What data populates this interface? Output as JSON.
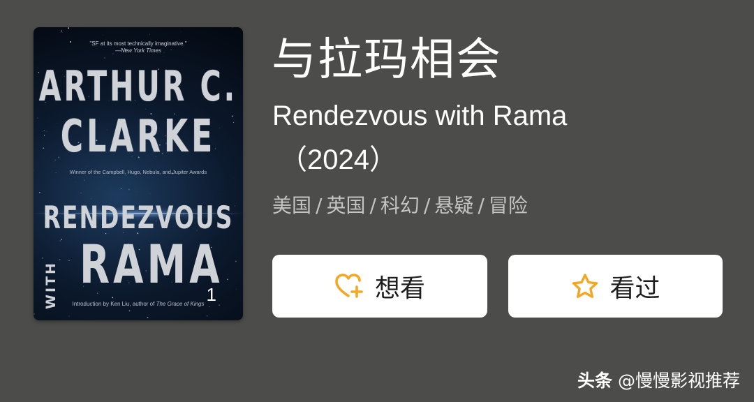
{
  "cover": {
    "quote": "\"SF at its most technically imaginative.\"",
    "quote_source": "—New York Times",
    "author_line1": "ARTHUR C.",
    "author_line2": "CLARKE",
    "awards": "Winner of the Campbell, Hugo, Nebula, and Jupiter Awards",
    "title_line1": "RENDEZVOUS",
    "title_with": "WITH",
    "title_line2": "RAMA",
    "intro_prefix": "Introduction by Ken Liu, author of ",
    "intro_book": "The Grace of Kings",
    "page_number": "1"
  },
  "movie": {
    "title_cn": "与拉玛相会",
    "title_en": "Rendezvous with Rama",
    "year": "（2024）",
    "tags": [
      "美国",
      "英国",
      "科幻",
      "悬疑",
      "冒险"
    ],
    "tag_separator": "/"
  },
  "actions": {
    "want_label": "想看",
    "seen_label": "看过"
  },
  "watermark": {
    "brand": "头条",
    "handle": "@慢慢影视推荐"
  },
  "colors": {
    "background": "#4c4d4b",
    "button_bg": "#ffffff",
    "icon_accent": "#f5a623",
    "tag_text": "#c4c5c3"
  }
}
